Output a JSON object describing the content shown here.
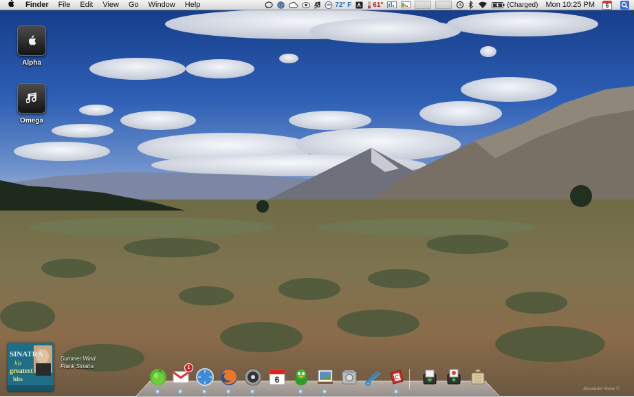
{
  "menubar": {
    "app_name": "Finder",
    "menus": [
      "File",
      "Edit",
      "View",
      "Go",
      "Window",
      "Help"
    ],
    "weather_temp": "72° F",
    "cpu_temp": "61°",
    "battery_status": "(Charged)",
    "clock": "Mon 10:25 PM",
    "calendar_day": "6"
  },
  "desktop": {
    "icons": [
      {
        "label": "Alpha",
        "icon": "apple-drive-icon"
      },
      {
        "label": "Omega",
        "icon": "music-drive-icon"
      }
    ]
  },
  "now_playing": {
    "title": "Summer Wind",
    "artist": "Frank Sinatra",
    "album_art_text": {
      "line1": "SINATRA",
      "line2": "his",
      "line3": "greatest",
      "line4": "hits"
    }
  },
  "dock": {
    "ical_day": "6",
    "mail_badge": "1",
    "apps": [
      "finder-icon",
      "gmail-notifier-icon",
      "safari-icon",
      "firefox-icon",
      "itunes-icon",
      "ical-icon",
      "adium-icon",
      "preview-icon",
      "disk-utility-icon",
      "scissors-icon",
      "calendar-red-icon",
      "downloads-stack-icon",
      "documents-stack-icon",
      "trash-icon"
    ]
  },
  "watermark": "Alexander Stone ©"
}
